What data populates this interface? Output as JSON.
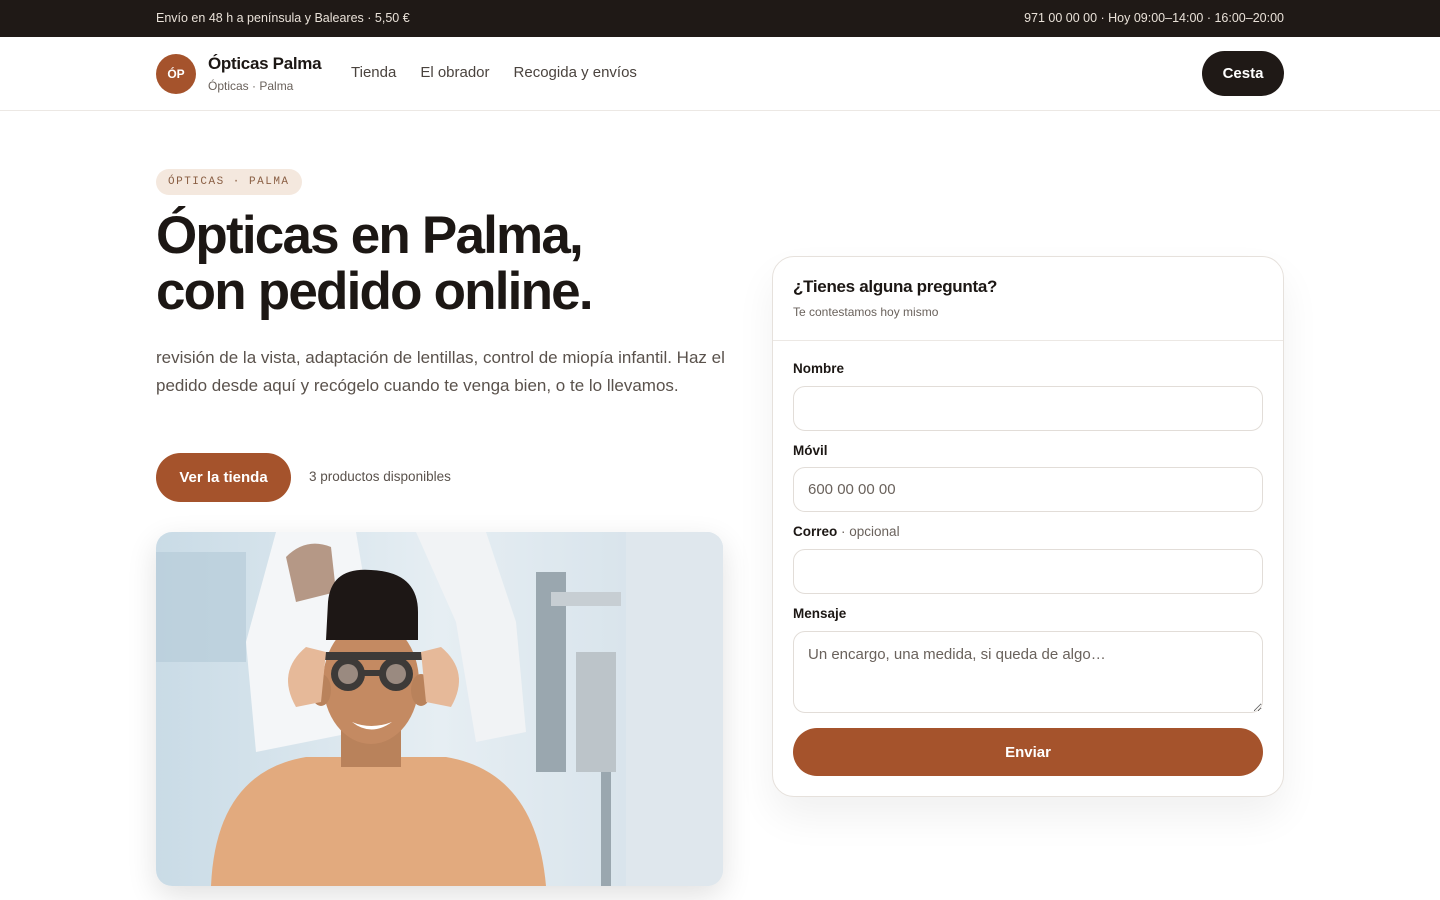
{
  "topbar": {
    "shipping": "Envío en 48 h a península y Baleares · 5,50 €",
    "contact": "971 00 00 00 · Hoy 09:00–14:00 · 16:00–20:00"
  },
  "brand": {
    "initials": "ÓP",
    "name": "Ópticas Palma",
    "sub": "Ópticas · Palma"
  },
  "nav": {
    "links": [
      "Tienda",
      "El obrador",
      "Recogida y envíos"
    ],
    "cart_label": "Cesta"
  },
  "hero": {
    "pill": "ÓPTICAS · PALMA",
    "title_line1": "Ópticas en Palma,",
    "title_line2": "con pedido online.",
    "description": "revisión de la vista, adaptación de lentillas, control de miopía infantil. Haz el pedido desde aquí y recógelo cuando te venga bien, o te lo llevamos.",
    "cta_label": "Ver la tienda",
    "availability": "3 productos disponibles"
  },
  "contact_form": {
    "title": "¿Tienes alguna pregunta?",
    "subtitle": "Te contestamos hoy mismo",
    "name_label": "Nombre",
    "name_value": "",
    "phone_label": "Móvil",
    "phone_placeholder": "600 00 00 00",
    "email_label": "Correo",
    "email_optional": "· opcional",
    "email_value": "",
    "message_label": "Mensaje",
    "message_placeholder": "Un encargo, una medida, si queda de algo…",
    "submit_label": "Enviar"
  },
  "colors": {
    "accent": "#a5532c",
    "dark": "#1f1916",
    "pill_bg": "#f4e8de"
  }
}
